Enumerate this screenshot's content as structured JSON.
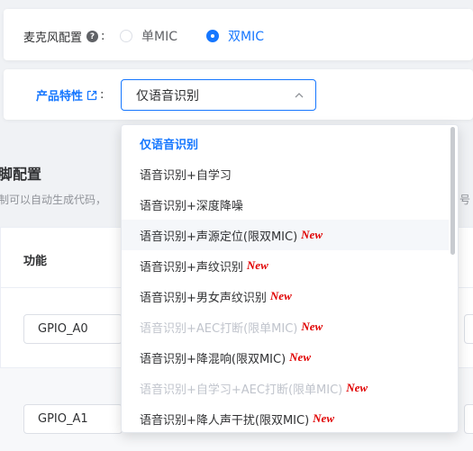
{
  "mic_config": {
    "label": "麦克风配置",
    "colon": ":",
    "options": [
      {
        "label": "单MIC",
        "checked": false
      },
      {
        "label": "双MIC",
        "checked": true
      }
    ]
  },
  "product": {
    "label": "产品特性",
    "colon": ":",
    "selected_value": "仅语音识别"
  },
  "background": {
    "section_title": "脚配置",
    "description": "制可以自动生成代码，",
    "description_right": "号",
    "column_header": "功能",
    "rows": [
      {
        "gpio": "GPIO_A0"
      },
      {
        "gpio": "GPIO_A1"
      }
    ]
  },
  "dropdown": {
    "new_tag": "New",
    "options": [
      {
        "label": "仅语音识别",
        "state": "selected",
        "is_new": false
      },
      {
        "label": "语音识别+自学习",
        "state": "normal",
        "is_new": false
      },
      {
        "label": "语音识别+深度降噪",
        "state": "normal",
        "is_new": false
      },
      {
        "label": "语音识别+声源定位(限双MIC)",
        "state": "hover",
        "is_new": true
      },
      {
        "label": "语音识别+声纹识别",
        "state": "normal",
        "is_new": true
      },
      {
        "label": "语音识别+男女声纹识别",
        "state": "normal",
        "is_new": true
      },
      {
        "label": "语音识别+AEC打断(限单MIC)",
        "state": "disabled",
        "is_new": true
      },
      {
        "label": "语音识别+降混响(限双MIC)",
        "state": "normal",
        "is_new": true
      },
      {
        "label": "语音识别+自学习+AEC打断(限单MIC)",
        "state": "disabled",
        "is_new": true
      },
      {
        "label": "语音识别+降人声干扰(限双MIC)",
        "state": "normal",
        "is_new": true
      }
    ]
  },
  "colors": {
    "accent": "#1677ff",
    "new_tag": "#e00000",
    "disabled_text": "#c0c4cc"
  }
}
